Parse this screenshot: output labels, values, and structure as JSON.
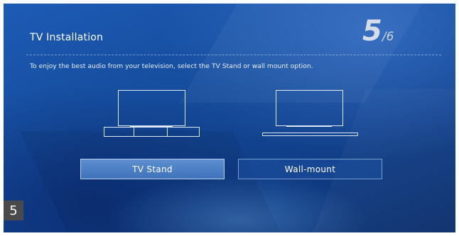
{
  "header": {
    "title": "TV Installation",
    "step_current": "5",
    "step_total": "/6"
  },
  "instruction": "To enjoy the best audio from your television, select the TV Stand or wall mount option.",
  "options": [
    {
      "label": "TV Stand",
      "illustration": "tv-on-stand-icon",
      "selected": true
    },
    {
      "label": "Wall-mount",
      "illustration": "tv-wall-mount-icon",
      "selected": false
    }
  ],
  "badge": "5",
  "colors": {
    "accent_button": "#4a80c6",
    "background": "#164e9f",
    "badge": "#4a4a4a"
  }
}
